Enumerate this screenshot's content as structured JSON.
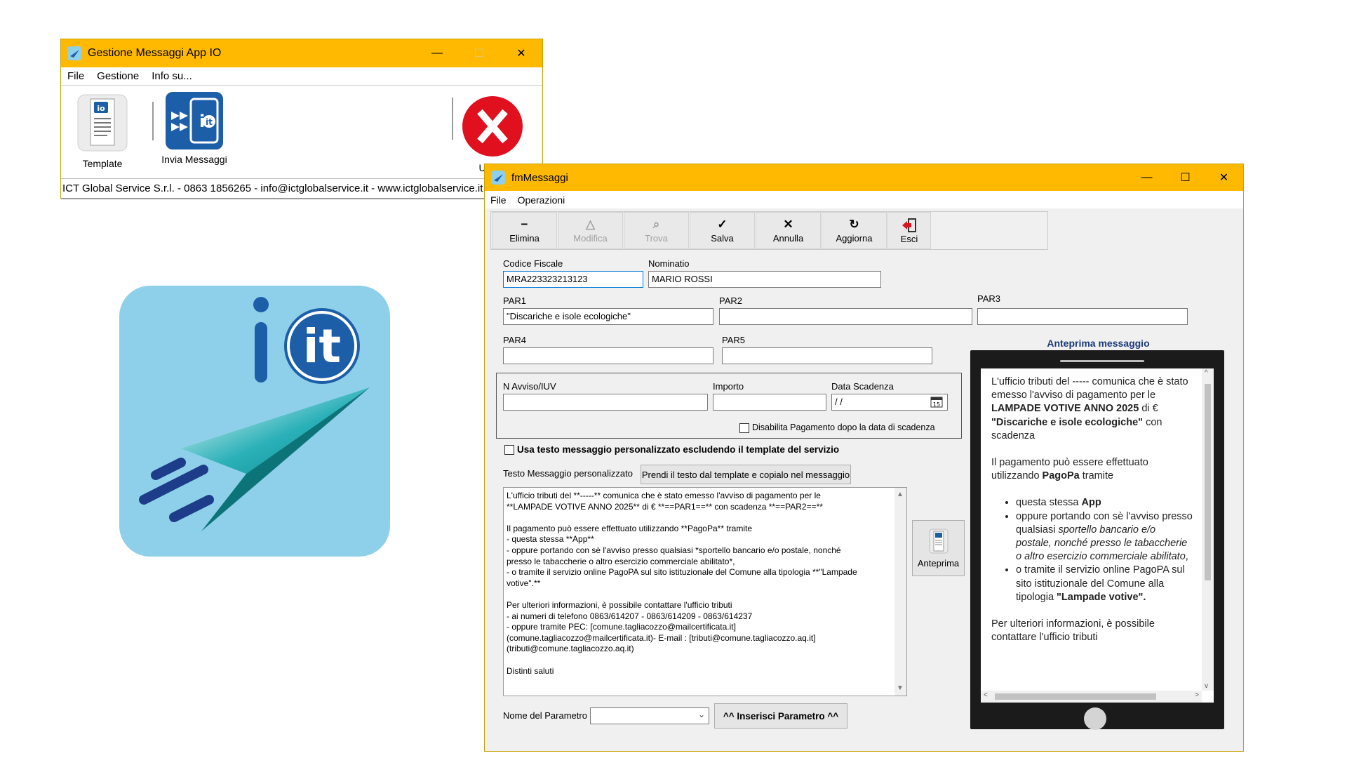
{
  "main_window": {
    "title": "Gestione Messaggi App IO",
    "controls": {
      "minimize": "—",
      "maximize": "☐",
      "close": "✕"
    },
    "menu": [
      "File",
      "Gestione",
      "Info su..."
    ],
    "tools": [
      {
        "label": "Template",
        "icon": "template-document-icon"
      },
      {
        "label": "Invia Messaggi",
        "icon": "send-messages-io-icon"
      },
      {
        "label": "Uscita",
        "icon": "exit-red-x-icon"
      }
    ],
    "status": "ICT Global Service S.r.l. - 0863 1856265 - info@ictglobalservice.it - www.ictglobalservice.it"
  },
  "logo_icon": "io-it-paper-plane-logo",
  "form_window": {
    "title": "fmMessaggi",
    "controls": {
      "minimize": "—",
      "maximize": "☐",
      "close": "✕"
    },
    "menu": [
      "File",
      "Operazioni"
    ],
    "toolbar": [
      {
        "label": "Elimina",
        "glyph": "−",
        "enabled": true
      },
      {
        "label": "Modifica",
        "glyph": "△",
        "enabled": false
      },
      {
        "label": "Trova",
        "glyph": "⌕",
        "enabled": false
      },
      {
        "label": "Salva",
        "glyph": "✓",
        "enabled": true
      },
      {
        "label": "Annulla",
        "glyph": "✕",
        "enabled": true
      },
      {
        "label": "Aggiorna",
        "glyph": "↻",
        "enabled": true
      },
      {
        "label": "Esci",
        "glyph": "⇥",
        "enabled": true
      }
    ],
    "fields": {
      "codice_fiscale": {
        "label": "Codice Fiscale",
        "value": "MRA223323213123"
      },
      "nominativo": {
        "label": "Nominatio",
        "value": "MARIO ROSSI"
      },
      "par1": {
        "label": "PAR1",
        "value": "\"Discariche e isole ecologiche\""
      },
      "par2": {
        "label": "PAR2",
        "value": ""
      },
      "par3": {
        "label": "PAR3",
        "value": ""
      },
      "par4": {
        "label": "PAR4",
        "value": ""
      },
      "par5": {
        "label": "PAR5",
        "value": ""
      },
      "n_avviso": {
        "label": "N Avviso/IUV",
        "value": ""
      },
      "importo": {
        "label": "Importo",
        "value": ""
      },
      "data_scadenza": {
        "label": "Data Scadenza",
        "value": " / /"
      },
      "disabilita_pagamento": {
        "label": "Disabilita Pagamento dopo la data di scadenza",
        "checked": false
      }
    },
    "usa_testo": {
      "label": "Usa testo messaggio personalizzato escludendo il template del servizio",
      "checked": false
    },
    "testo_label": "Testo Messaggio personalizzato",
    "prendi_button": "Prendi il testo dal template e copialo nel messaggio",
    "message_lines": [
      "L'ufficio tributi del **-----** comunica che è stato emesso l'avviso di pagamento per le",
      "**LAMPADE VOTIVE ANNO 2025**  di € **==PAR1==** con scadenza **==PAR2==**",
      "",
      "Il pagamento può essere effettuato utilizzando **PagoPa** tramite",
      "- questa stessa **App**",
      "- oppure portando con sè l'avviso presso qualsiasi *sportello bancario e/o postale, nonché",
      "presso le tabaccherie o altro esercizio commerciale abilitato*,",
      "- o tramite il servizio online PagoPA sul sito istituzionale del Comune alla tipologia **\"Lampade",
      "votive\".**",
      "",
      "Per ulteriori informazioni, è possibile contattare l'ufficio tributi",
      "- ai numeri di telefono 0863/614207 - 0863/614209 - 0863/614237",
      "- oppure tramite PEC: [comune.tagliacozzo@mailcertificata.it]",
      "(comune.tagliacozzo@mailcertificata.it)- E-mail : [tributi@comune.tagliacozzo.aq.it]",
      "(tributi@comune.tagliacozzo.aq.it)",
      "",
      "Distinti saluti"
    ],
    "anteprima_button": "Anteprima",
    "nome_parametro_label": "Nome del Parametro",
    "nome_parametro_value": "",
    "inserisci_button": "^^ Inserisci Parametro ^^",
    "preview": {
      "title": "Anteprima messaggio",
      "p1_a": "L'ufficio tributi del ----- comunica che è stato emesso l'avviso di pagamento per le ",
      "p1_b": "LAMPADE VOTIVE ANNO 2025",
      "p1_c": " di € ",
      "p1_d": "\"Discariche e isole ecologiche\"",
      "p1_e": " con scadenza",
      "p2_a": "Il pagamento può essere effettuato utilizzando ",
      "p2_b": "PagoPa",
      "p2_c": " tramite",
      "li1_a": "questa stessa ",
      "li1_b": "App",
      "li2_a": "oppure portando con sè l'avviso presso qualsiasi ",
      "li2_b": "sportello bancario e/o postale, nonché presso le tabaccherie o altro esercizio commerciale abilitato",
      "li2_c": ",",
      "li3_a": "o tramite il servizio online PagoPA sul sito istituzionale del Comune alla tipologia ",
      "li3_b": "\"Lampade votive\".",
      "p3": "Per ulteriori informazioni, è possibile contattare l'ufficio tributi"
    }
  }
}
